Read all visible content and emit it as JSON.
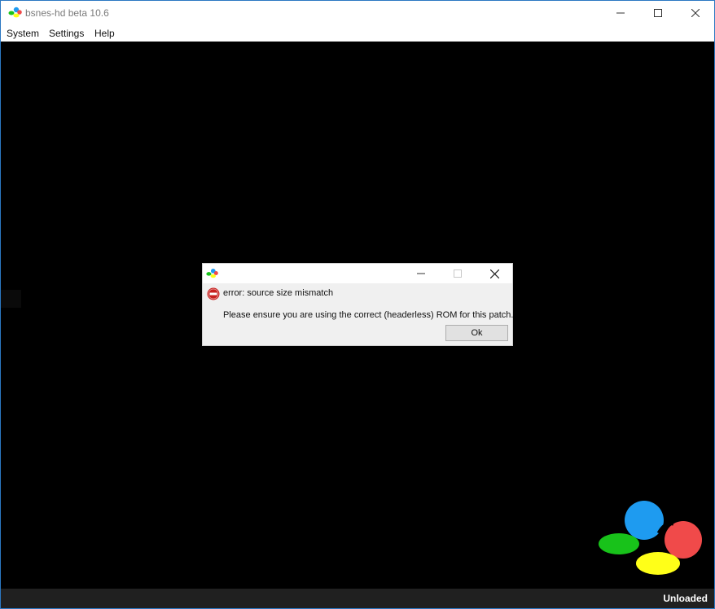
{
  "window": {
    "title": "bsnes-hd beta 10.6",
    "controls": {
      "minimize": "minimize-icon",
      "maximize": "maximize-icon",
      "close": "close-icon"
    }
  },
  "menu": {
    "items": [
      {
        "label": "System"
      },
      {
        "label": "Settings"
      },
      {
        "label": "Help"
      }
    ]
  },
  "status": {
    "text": "Unloaded"
  },
  "dialog": {
    "title": "",
    "error_title": "error: source size mismatch",
    "message": "Please ensure you are using the correct (headerless) ROM for this patch.",
    "ok_label": "Ok",
    "icons": {
      "app": "snes-logo-icon",
      "error": "error-icon"
    }
  },
  "colors": {
    "viewport_bg": "#000000",
    "statusbar_bg": "#202020",
    "logo_blue": "#1e9bf0",
    "logo_red": "#f04a4a",
    "logo_green": "#18c21a",
    "logo_yellow": "#ffff18",
    "error_red": "#c8201e",
    "window_border": "#2b78c2"
  }
}
